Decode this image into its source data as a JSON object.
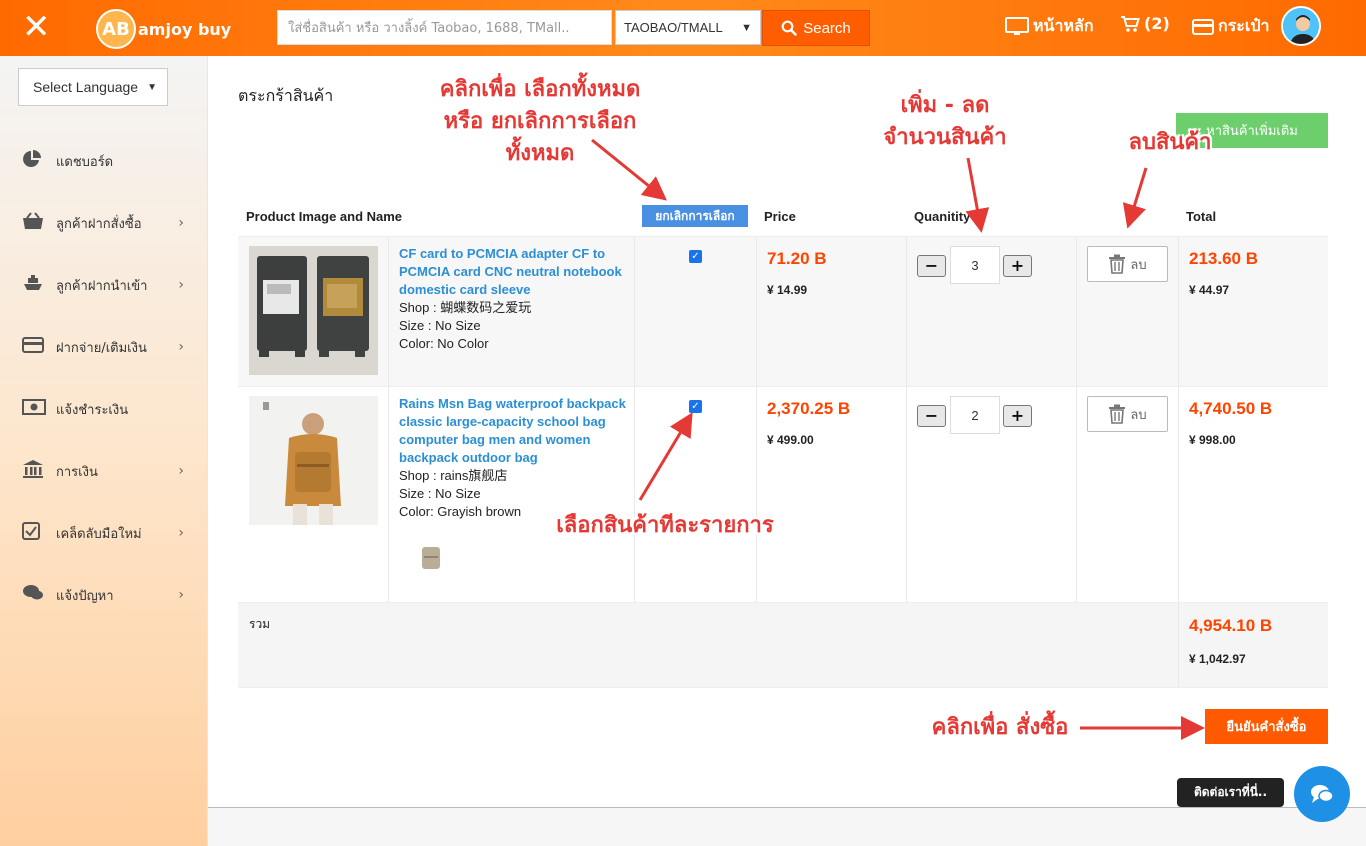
{
  "header": {
    "logo_mark": "AB",
    "logo_text": "amjoy buy",
    "search_placeholder": "ใส่ชื่อสินค้า หรือ วางลิ้งค์ Taobao, 1688, TMall..",
    "search_source": "TAOBAO/TMALL",
    "search_button": "Search",
    "nav_home": "หน้าหลัก",
    "nav_cart": "(2)",
    "nav_wallet": "กระเป๋า"
  },
  "sidebar": {
    "language_select": "Select Language",
    "items": [
      {
        "label": "แดชบอร์ด",
        "icon": "pie-chart-icon"
      },
      {
        "label": "ลูกค้าฝากสั่งซื้อ",
        "icon": "basket-icon"
      },
      {
        "label": "ลูกค้าฝากนำเข้า",
        "icon": "ship-icon"
      },
      {
        "label": "ฝากจ่าย/เติมเงิน",
        "icon": "credit-card-icon"
      },
      {
        "label": "แจ้งชำระเงิน",
        "icon": "money-icon"
      },
      {
        "label": "การเงิน",
        "icon": "bank-icon"
      },
      {
        "label": "เคล็ดลับมือใหม่",
        "icon": "checkbox-icon"
      },
      {
        "label": "แจ้งปัญหา",
        "icon": "comments-icon"
      }
    ]
  },
  "main": {
    "page_title": "ตระกร้าสินค้า",
    "more_button": "หาสินค้าเพิ่มเติม",
    "columns": {
      "product": "Product Image and Name",
      "deselect_all": "ยกเลิกการเลือก",
      "price": "Price",
      "quantity": "Quanitity",
      "total": "Total"
    },
    "items": [
      {
        "name": "CF card to PCMCIA adapter CF to PCMCIA card CNC neutral notebook domestic card sleeve",
        "shop": "Shop : 蝴蝶数码之爱玩",
        "size": "Size : No Size",
        "color": "Color: No Color",
        "price_thb": "71.20 B",
        "price_cny": "¥ 14.99",
        "quantity": "3",
        "delete_label": "ลบ",
        "total_thb": "213.60 B",
        "total_cny": "¥ 44.97",
        "checked": true
      },
      {
        "name": "Rains Msn Bag waterproof backpack classic large-capacity school bag computer bag men and women backpack outdoor bag",
        "shop": "Shop : rains旗舰店",
        "size": "Size : No Size",
        "color": "Color: Grayish brown",
        "price_thb": "2,370.25 B",
        "price_cny": "¥ 499.00",
        "quantity": "2",
        "delete_label": "ลบ",
        "total_thb": "4,740.50 B",
        "total_cny": "¥ 998.00",
        "checked": true
      }
    ],
    "sum_label": "รวม",
    "sum_thb": "4,954.10 B",
    "sum_cny": "¥ 1,042.97",
    "confirm_button": "ยืนยันคำสั่งซื้อ"
  },
  "footer": {
    "contact_label": "ติดต่อเราที่นี่.."
  },
  "annotations": {
    "select_all": [
      "คลิกเพื่อ เลือกทั้งหมด",
      "หรือ ยกเลิกการเลือก",
      "ทั้งหมด"
    ],
    "quantity": [
      "เพิ่ม - ลด",
      "จำนวนสินค้า"
    ],
    "delete": "ลบสินค้า",
    "select_item": "เลือกสินค้าทีละรายการ",
    "order": "คลิกเพื่อ สั่งซื้อ"
  },
  "colors": {
    "brand_orange": "#ff6a00",
    "link_blue": "#2b8fd6",
    "price_red": "#ff4400",
    "annotation_red": "#e53935",
    "more_green": "#6ccf6c"
  }
}
